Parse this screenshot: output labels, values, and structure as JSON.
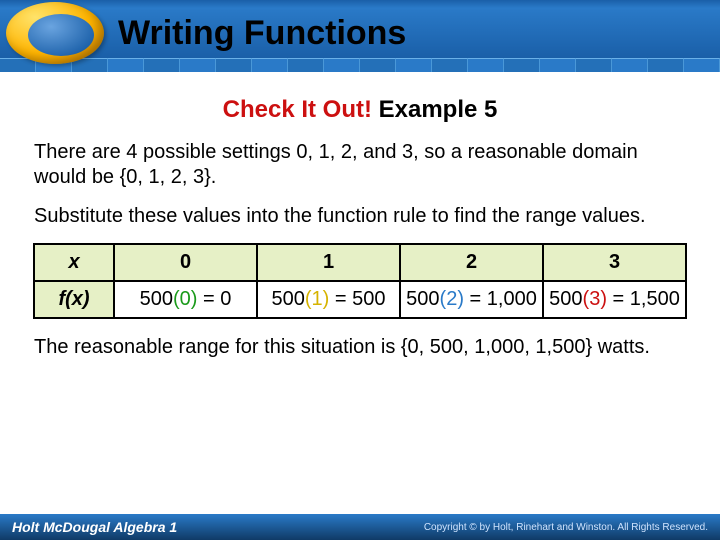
{
  "header": {
    "title": "Writing Functions"
  },
  "subtitle": {
    "red": "Check It Out!",
    "black": " Example 5"
  },
  "para1": "There are 4 possible settings  0, 1, 2, and 3, so a reasonable domain would be {0, 1, 2, 3}.",
  "para2": "Substitute these values into the function rule to find the range values.",
  "table": {
    "row_labels": {
      "x": "x",
      "fx": "f(x)"
    },
    "cols": [
      {
        "x": "0",
        "fx_pre": "500",
        "fx_hl": "(0)",
        "fx_post": " = 0",
        "cls": "hl0"
      },
      {
        "x": "1",
        "fx_pre": "500",
        "fx_hl": "(1)",
        "fx_post": " = 500",
        "cls": "hl1"
      },
      {
        "x": "2",
        "fx_pre": "500",
        "fx_hl": "(2)",
        "fx_post": " = 1,000",
        "cls": "hl2"
      },
      {
        "x": "3",
        "fx_pre": "500",
        "fx_hl": "(3)",
        "fx_post": " = 1,500",
        "cls": "hl3"
      }
    ]
  },
  "para3": "The reasonable range for this situation is {0, 500, 1,000, 1,500} watts.",
  "footer": {
    "publisher": "Holt McDougal Algebra 1",
    "copyright": "Copyright © by Holt, Rinehart and Winston. All Rights Reserved."
  }
}
